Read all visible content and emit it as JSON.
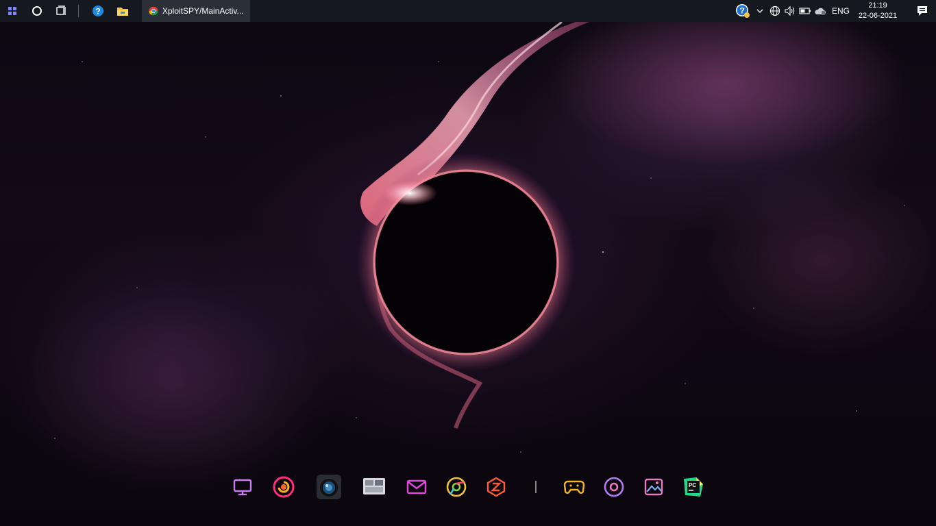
{
  "taskbar": {
    "start_icon": "start-menu-icon",
    "search_icon": "cortana-circle-icon",
    "taskview_icon": "task-view-icon",
    "pinned": [
      {
        "name": "help-icon"
      },
      {
        "name": "file-explorer-icon"
      }
    ],
    "active_window": {
      "icon": "chrome-icon",
      "title": "XploitSPY/MainActiv..."
    }
  },
  "tray": {
    "icons": [
      "help-tray-icon",
      "chevron-up-icon",
      "network-globe-icon",
      "volume-icon",
      "battery-icon",
      "onedrive-cloud-icon"
    ],
    "language": "ENG",
    "time": "21:19",
    "date": "22-06-2021",
    "notification_icon": "action-center-icon"
  },
  "dock": {
    "items": [
      {
        "name": "this-pc-icon",
        "color": "#c87cf0"
      },
      {
        "name": "firefox-icon",
        "color": "#ff2d7a"
      },
      {
        "name": "camera-icon",
        "color": "#4a90c8"
      },
      {
        "name": "photos-app-icon",
        "color": "#8a8f98"
      },
      {
        "name": "mail-icon",
        "color": "#e04ad8"
      },
      {
        "name": "chrome-dock-icon",
        "color": "#f0c23a"
      },
      {
        "name": "filezilla-icon",
        "color": "#ff5a3a"
      },
      {
        "name": "dock-separator",
        "color": "#bbbbbb"
      },
      {
        "name": "gamepad-icon",
        "color": "#f2b91e"
      },
      {
        "name": "disc-icon",
        "color": "#b07cf0"
      },
      {
        "name": "gallery-icon",
        "color": "#e87ac0"
      },
      {
        "name": "pycharm-icon",
        "color": "#21d789"
      }
    ]
  },
  "colors": {
    "taskbar_bg": "#15181f",
    "active_task_bg": "#2b2f37",
    "eclipse_glow": "#f07a8a"
  }
}
